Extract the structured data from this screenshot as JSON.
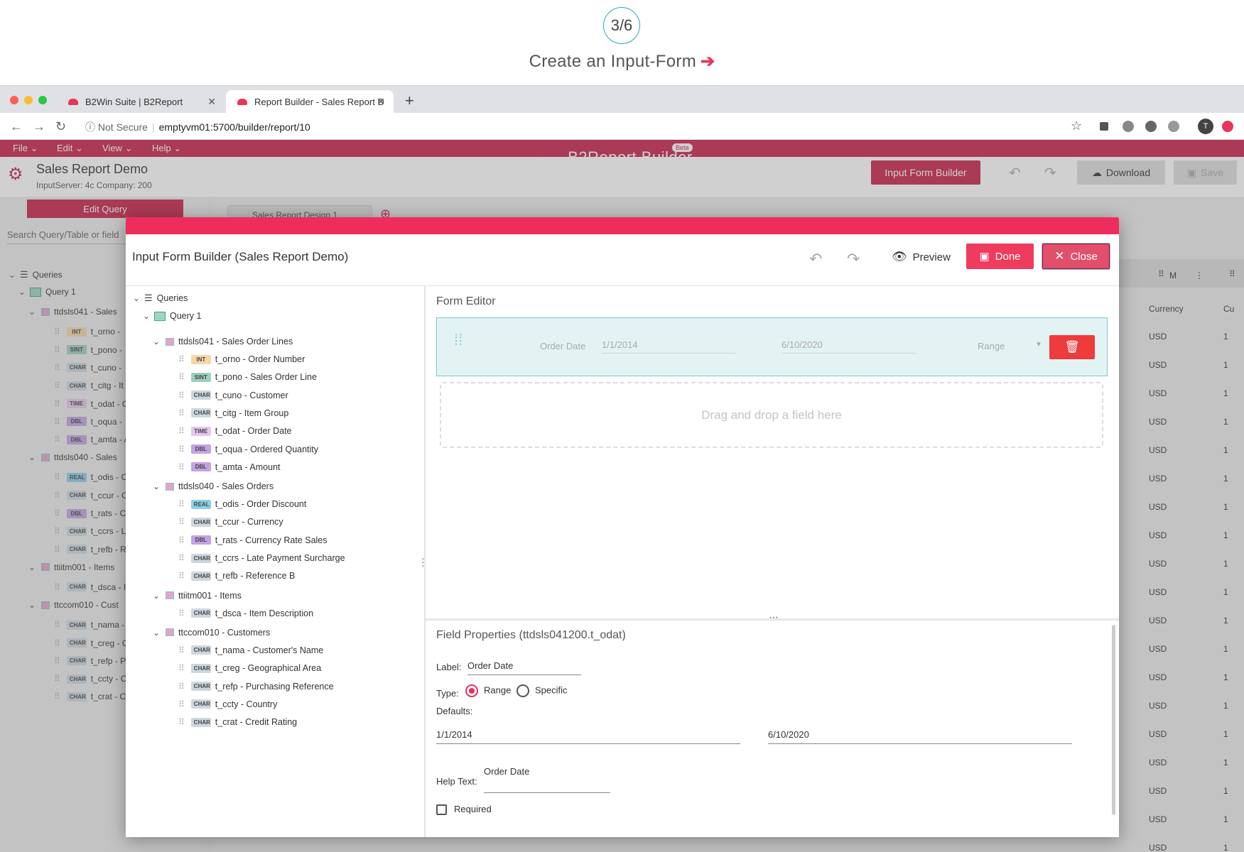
{
  "step": {
    "counter": "3/6",
    "title": "Create an Input-Form",
    "arrow": "➔"
  },
  "browser": {
    "tabs": [
      {
        "label": "B2Win Suite | B2Report"
      },
      {
        "label": "Report Builder - Sales Report D"
      }
    ],
    "security": "Not Secure",
    "url": "emptyvm01:5700/builder/report/10",
    "user_initial": "T"
  },
  "app": {
    "menu": [
      "File",
      "Edit",
      "View",
      "Help"
    ],
    "brand": "B2Report Builder",
    "beta": "Beta",
    "title": "Sales Report Demo",
    "subtitle": "InputServer: 4c   Company: 200",
    "buttons": {
      "input_form_builder": "Input Form Builder",
      "download": "Download",
      "save": "Save"
    },
    "edit_query": "Edit Query",
    "search_placeholder": "Search Query/Table or field",
    "design_tab": "Sales Report Design 1",
    "grid": {
      "col_m": "M",
      "col_currency": "Currency",
      "col_cu": "Cu",
      "currency_value": "USD",
      "cu_value": "1"
    },
    "bg_tree": [
      "Queries",
      "Query 1",
      "ttdsls041 - Sales",
      "t_orno -",
      "t_pono -",
      "t_cuno -",
      "t_citg - It",
      "t_odat - C",
      "t_oqua -",
      "t_amta - A",
      "ttdsls040 - Sales",
      "t_odis - C",
      "t_ccur - C",
      "t_rats - C",
      "t_ccrs - L",
      "t_refb - R",
      "ttiitm001 - Items",
      "t_dsca - I",
      "ttccom010 - Cust",
      "t_nama -",
      "t_creg - G",
      "t_refp - P",
      "t_ccty - C",
      "t_crat - C"
    ]
  },
  "dialog": {
    "title": "Input Form Builder (Sales Report Demo)",
    "preview": "Preview",
    "done": "Done",
    "close": "Close",
    "tree": {
      "root": "Queries",
      "query": "Query 1",
      "tables": [
        {
          "name": "ttdsls041 - Sales Order Lines",
          "fields": [
            {
              "type": "INT",
              "label": "t_orno - Order Number"
            },
            {
              "type": "SINT",
              "label": "t_pono - Sales Order Line"
            },
            {
              "type": "CHAR",
              "label": "t_cuno - Customer"
            },
            {
              "type": "CHAR",
              "label": "t_citg - Item Group"
            },
            {
              "type": "TIME",
              "label": "t_odat - Order Date"
            },
            {
              "type": "DBL",
              "label": "t_oqua - Ordered Quantity"
            },
            {
              "type": "DBL",
              "label": "t_amta - Amount"
            }
          ]
        },
        {
          "name": "ttdsls040 - Sales Orders",
          "fields": [
            {
              "type": "REAL",
              "label": "t_odis - Order Discount"
            },
            {
              "type": "CHAR",
              "label": "t_ccur - Currency"
            },
            {
              "type": "DBL",
              "label": "t_rats - Currency Rate Sales"
            },
            {
              "type": "CHAR",
              "label": "t_ccrs - Late Payment Surcharge"
            },
            {
              "type": "CHAR",
              "label": "t_refb - Reference B"
            }
          ]
        },
        {
          "name": "ttiitm001 - Items",
          "fields": [
            {
              "type": "CHAR",
              "label": "t_dsca - Item Description"
            }
          ]
        },
        {
          "name": "ttccom010 - Customers",
          "fields": [
            {
              "type": "CHAR",
              "label": "t_nama - Customer's Name"
            },
            {
              "type": "CHAR",
              "label": "t_creg - Geographical Area"
            },
            {
              "type": "CHAR",
              "label": "t_refp - Purchasing Reference"
            },
            {
              "type": "CHAR",
              "label": "t_ccty - Country"
            },
            {
              "type": "CHAR",
              "label": "t_crat - Credit Rating"
            }
          ]
        }
      ]
    },
    "form_editor": {
      "title": "Form Editor",
      "field": {
        "label": "Order Date",
        "from": "1/1/2014",
        "to": "6/10/2020",
        "mode": "Range"
      },
      "dropzone": "Drag and drop a field here"
    },
    "field_properties": {
      "title": "Field Properties (ttdsls041200.t_odat)",
      "label_caption": "Label:",
      "label_value": "Order Date",
      "type_caption": "Type:",
      "type_options": [
        "Range",
        "Specific"
      ],
      "type_selected": "Range",
      "defaults_caption": "Defaults:",
      "default_from": "1/1/2014",
      "default_to": "6/10/2020",
      "help_caption": "Help Text:",
      "help_value": "Order Date",
      "required_caption": "Required",
      "required_checked": false
    }
  },
  "colors": {
    "accent": "#ee2d5c",
    "brand": "#c8234a",
    "selected_field_bg": "#e3f3f3",
    "teal": "#2aa7b4"
  }
}
